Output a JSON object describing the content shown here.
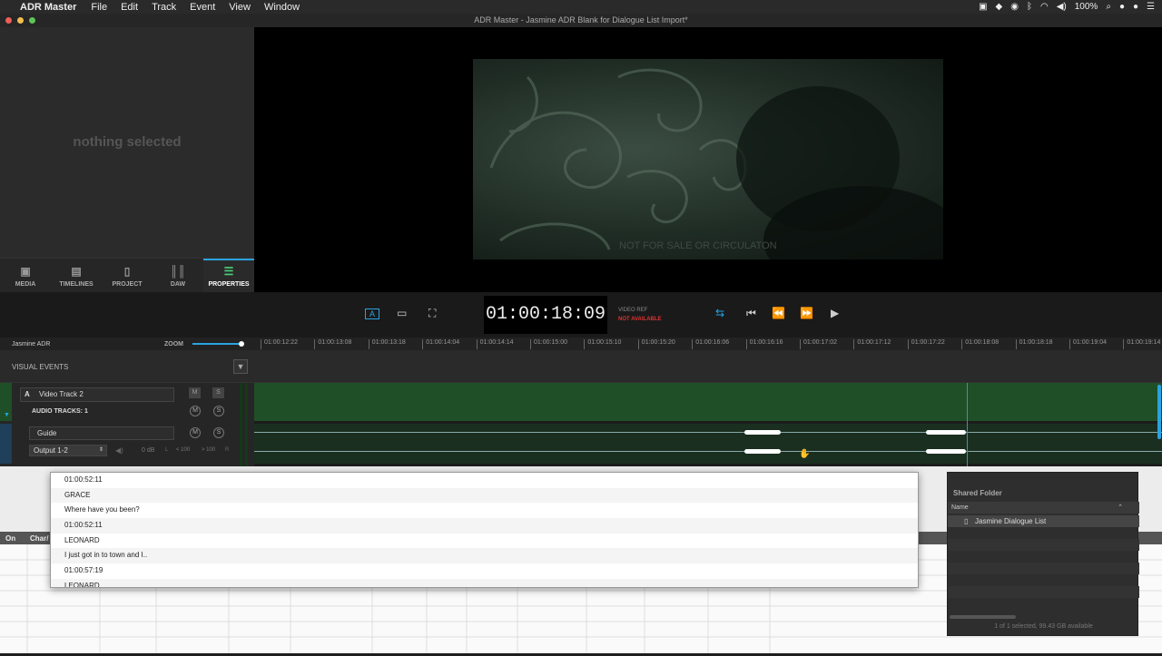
{
  "menubar": {
    "apple": "",
    "app_name": "ADR Master",
    "items": [
      "File",
      "Edit",
      "Track",
      "Event",
      "View",
      "Window"
    ],
    "battery": "100%"
  },
  "window": {
    "title": "ADR Master - Jasmine ADR Blank for Dialogue List Import*"
  },
  "properties_panel": {
    "empty_text": "nothing selected"
  },
  "nav_tabs": [
    {
      "label": "MEDIA",
      "icon": "media-icon"
    },
    {
      "label": "TIMELINES",
      "icon": "timelines-icon"
    },
    {
      "label": "PROJECT",
      "icon": "project-icon"
    },
    {
      "label": "DAW",
      "icon": "daw-icon"
    },
    {
      "label": "PROPERTIES",
      "icon": "properties-icon",
      "active": true
    }
  ],
  "video": {
    "watermark": "NOT FOR SALE OR CIRCULATON"
  },
  "transport": {
    "timecode": "01:00:18:09",
    "video_ref_label": "VIDEO REF",
    "video_ref_status": "NOT AVAILABLE"
  },
  "ruler": {
    "project_name": "Jasmine ADR",
    "zoom_label": "ZOOM",
    "ticks": [
      "01:00:12:22",
      "01:00:13:08",
      "01:00:13:18",
      "01:00:14:04",
      "01:00:14:14",
      "01:00:15:00",
      "01:00:15:10",
      "01:00:15:20",
      "01:00:16:06",
      "01:00:16:16",
      "01:00:17:02",
      "01:00:17:12",
      "01:00:17:22",
      "01:00:18:08",
      "01:00:18:18",
      "01:00:19:04",
      "01:00:19:14"
    ]
  },
  "visual_events": {
    "label": "VISUAL EVENTS"
  },
  "tracks": {
    "video_track_letter": "A",
    "video_track_name": "Video Track 2",
    "audio_tracks_label": "AUDIO TRACKS: 1",
    "audio_track_name": "Guide",
    "output": "Output 1-2",
    "volume": "0 dB",
    "pan_left": "< 100",
    "pan_right": "> 100",
    "mute": "M",
    "solo": "S",
    "l": "L",
    "r": "R"
  },
  "dialogue_list": {
    "rows": [
      "01:00:52:11",
      "GRACE",
      "Where have you been?",
      "01:00:52:11",
      "LEONARD",
      "I just got in to town and I..",
      "01:00:57:19",
      "LEONARD"
    ]
  },
  "grid": {
    "col_on": "On",
    "col_char": "Char/"
  },
  "finder": {
    "shared_folder": "Shared Folder",
    "name_header": "Name",
    "item": "Jasmine Dialogue List",
    "status": "1 of 1 selected, 99.43 GB available"
  }
}
